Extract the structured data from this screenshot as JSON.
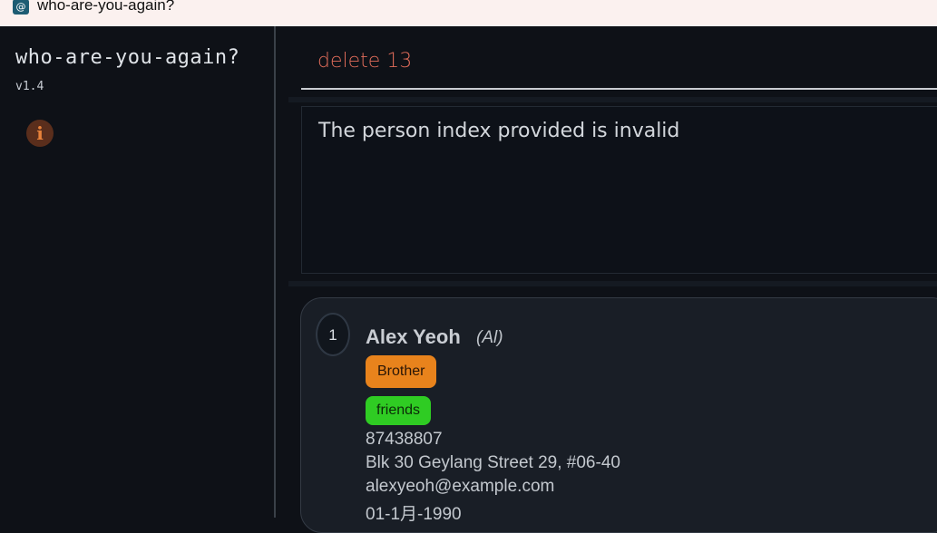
{
  "window": {
    "title": "who-are-you-again?",
    "icon": "notebook-at-icon"
  },
  "sidebar": {
    "app_name": "who-are-you-again?",
    "version": "v1.4",
    "info_button": {
      "icon": "info-icon",
      "glyph": "i"
    }
  },
  "command": {
    "text": "delete 13"
  },
  "result": {
    "message": "The person index provided is invalid"
  },
  "persons": [
    {
      "index": "1",
      "name": "Alex Yeoh",
      "nickname": "(Al)",
      "relationship": "Brother",
      "tags": [
        "friends"
      ],
      "phone": "87438807",
      "address": "Blk 30 Geylang Street 29, #06-40",
      "email": "alexyeoh@example.com",
      "birthday": "01-1月-1990"
    }
  ],
  "colors": {
    "background": "#0e1117",
    "command_text": "#e06c5a",
    "relationship_tag": "#e8831c",
    "group_tag": "#2fcc23",
    "info_icon": "#e8823a"
  }
}
